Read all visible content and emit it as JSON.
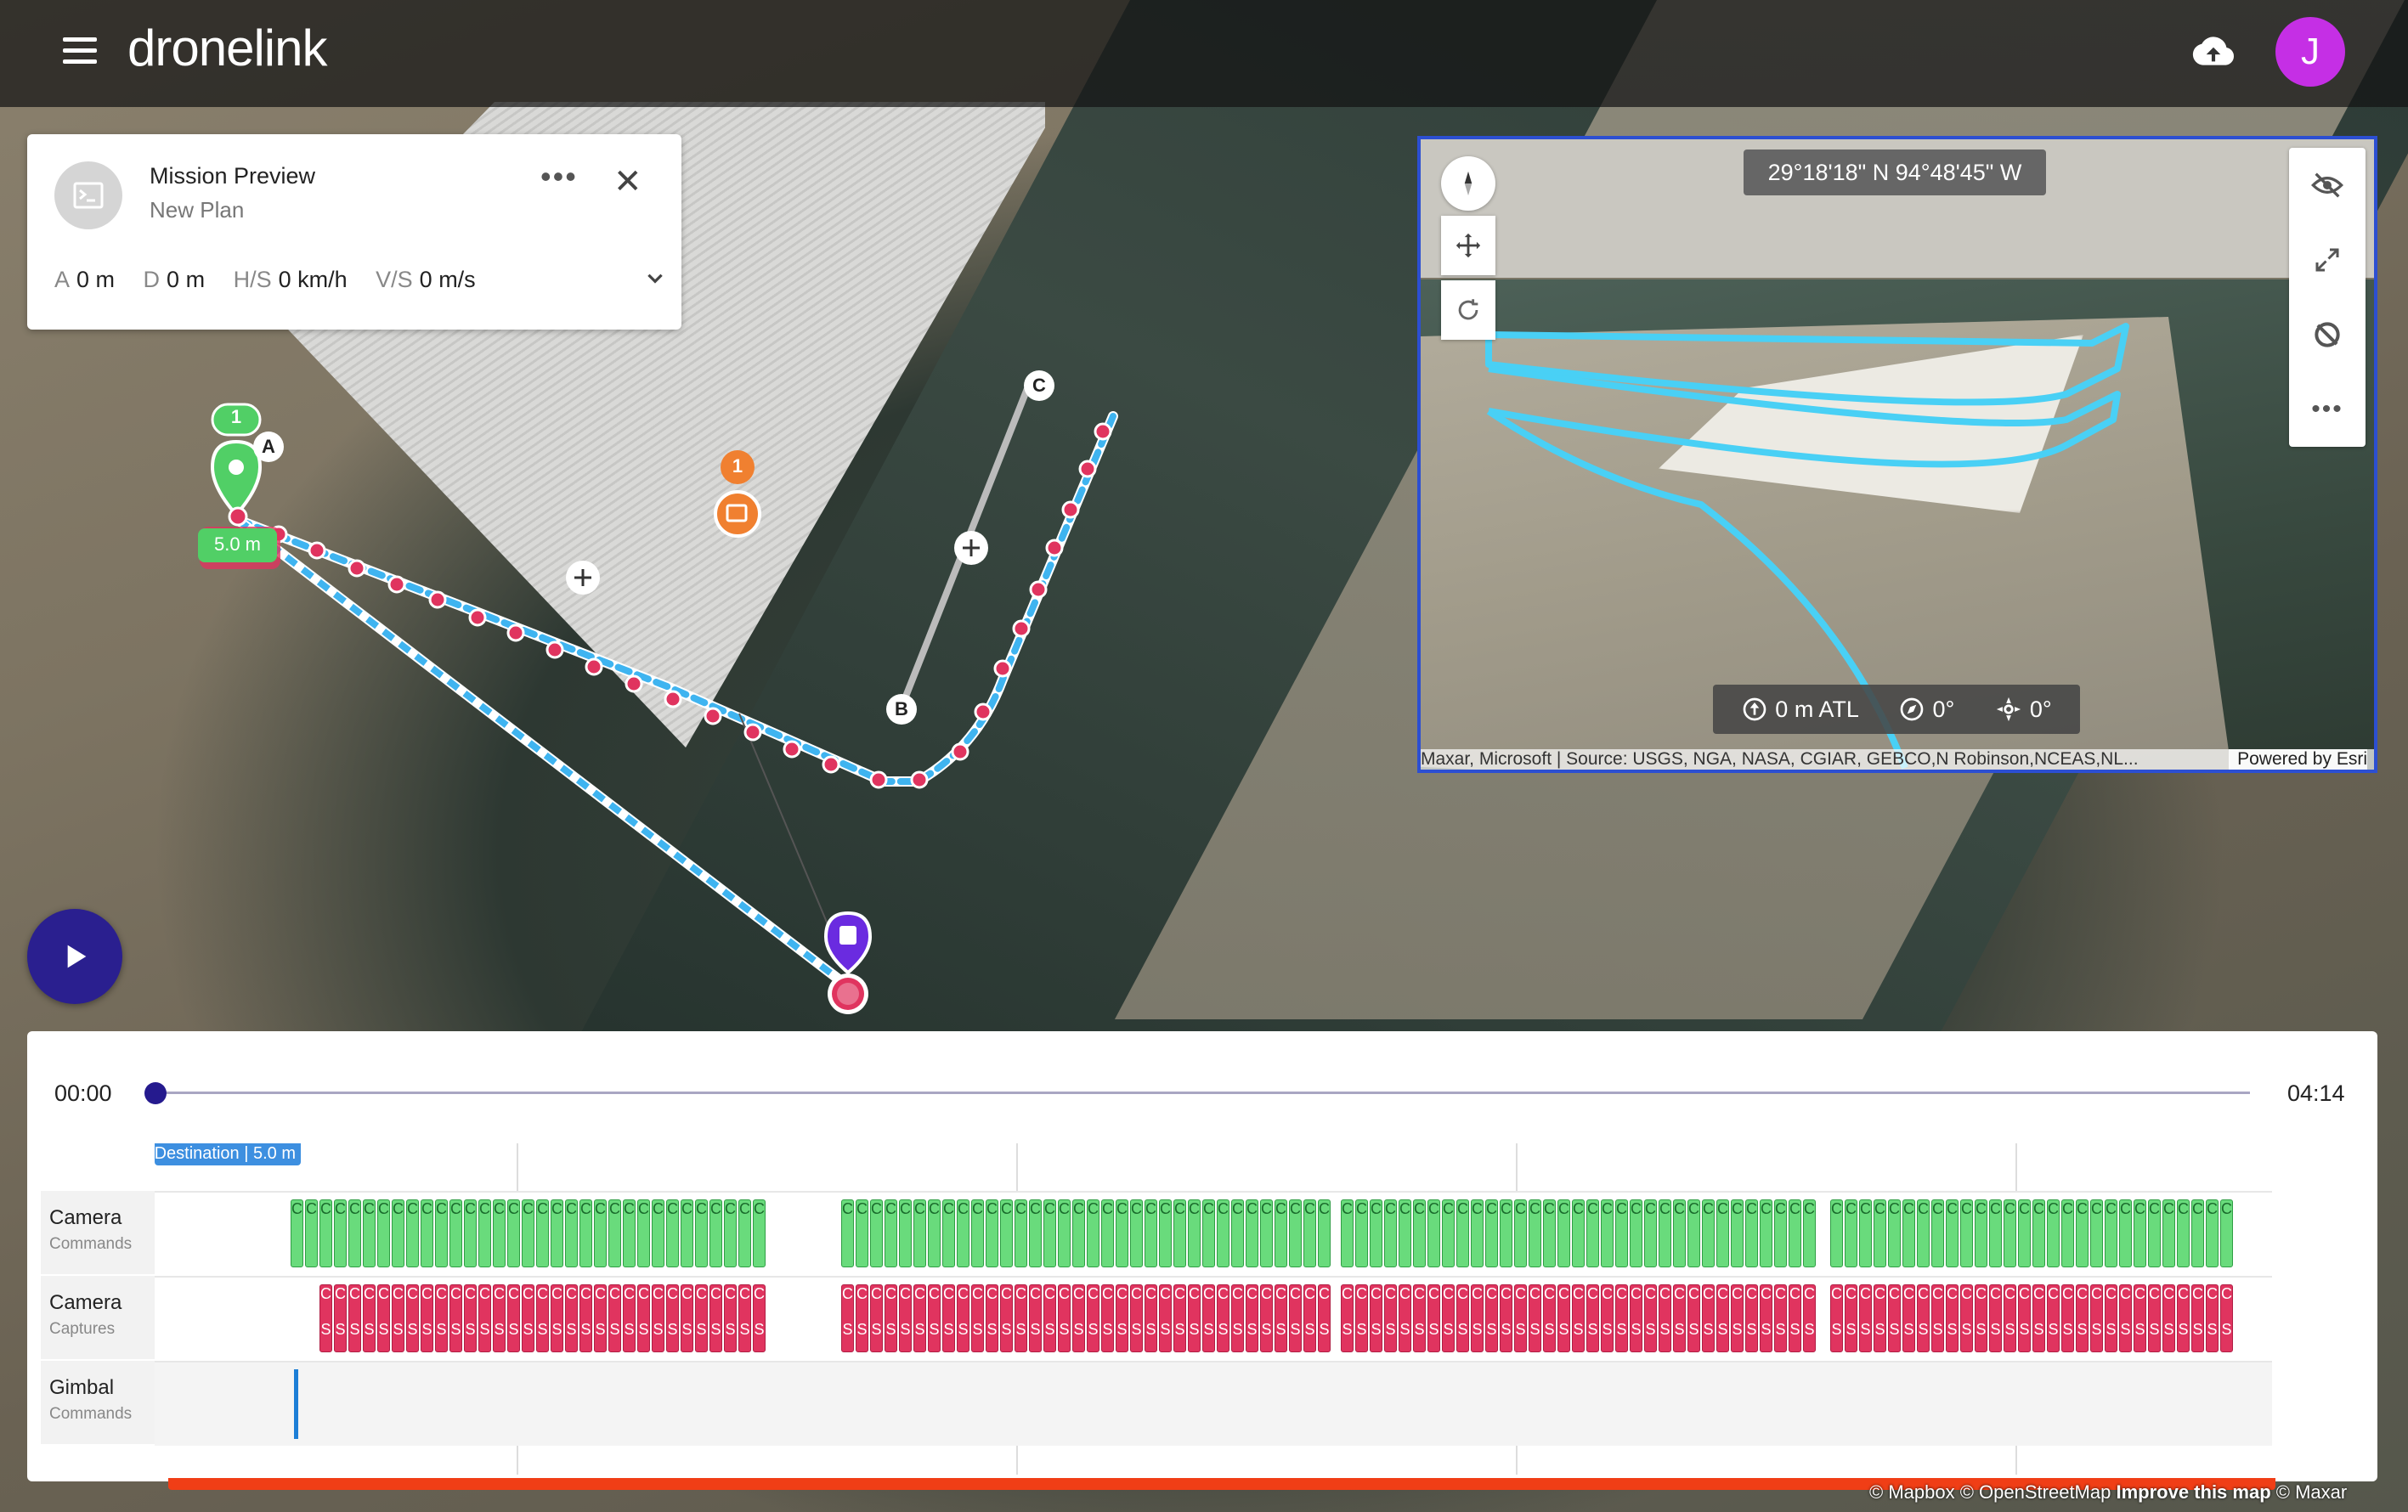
{
  "app": {
    "logo": "dronelink",
    "user_initial": "J"
  },
  "mission": {
    "title": "Mission Preview",
    "subtitle": "New Plan",
    "stats": [
      {
        "label": "A",
        "value": "0 m"
      },
      {
        "label": "D",
        "value": "0 m"
      },
      {
        "label": "H/S",
        "value": "0 km/h"
      },
      {
        "label": "V/S",
        "value": "0 m/s"
      }
    ]
  },
  "map": {
    "markers": {
      "a": "A",
      "b": "B",
      "c": "C",
      "start_count": "1",
      "poi_count": "1",
      "altitude_tag": "5.0 m"
    },
    "attribution": {
      "mapbox": "© Mapbox",
      "osm": "© OpenStreetMap",
      "improve": "Improve this map",
      "maxar": "© Maxar"
    }
  },
  "preview": {
    "coordinates": "29°18'18\" N 94°48'45\" W",
    "altitude": "0 m ATL",
    "heading": "0°",
    "gimbal": "0°",
    "attribution": "Maxar, Microsoft | Source: USGS, NGA, NASA, CGIAR, GEBCO,N Robinson,NCEAS,NL...",
    "powered_by": "Powered by Esri"
  },
  "timeline": {
    "start_time": "00:00",
    "end_time": "04:14",
    "progress": 0,
    "destination_label": "Destination | 5.0 m",
    "rows": [
      {
        "title": "Camera",
        "subtitle": "Commands",
        "chip_glyph": "C"
      },
      {
        "title": "Camera",
        "subtitle": "Captures",
        "chip_glyph": "S"
      },
      {
        "title": "Gimbal",
        "subtitle": "Commands"
      }
    ]
  },
  "colors": {
    "accent": "#2a1f8f",
    "path": "#3fb4f0",
    "waypoint": "#e0345f",
    "avatar": "#c52fe5",
    "command_chip": "#69db7c",
    "capture_chip": "#e0345f",
    "red_bar": "#f03e16"
  }
}
